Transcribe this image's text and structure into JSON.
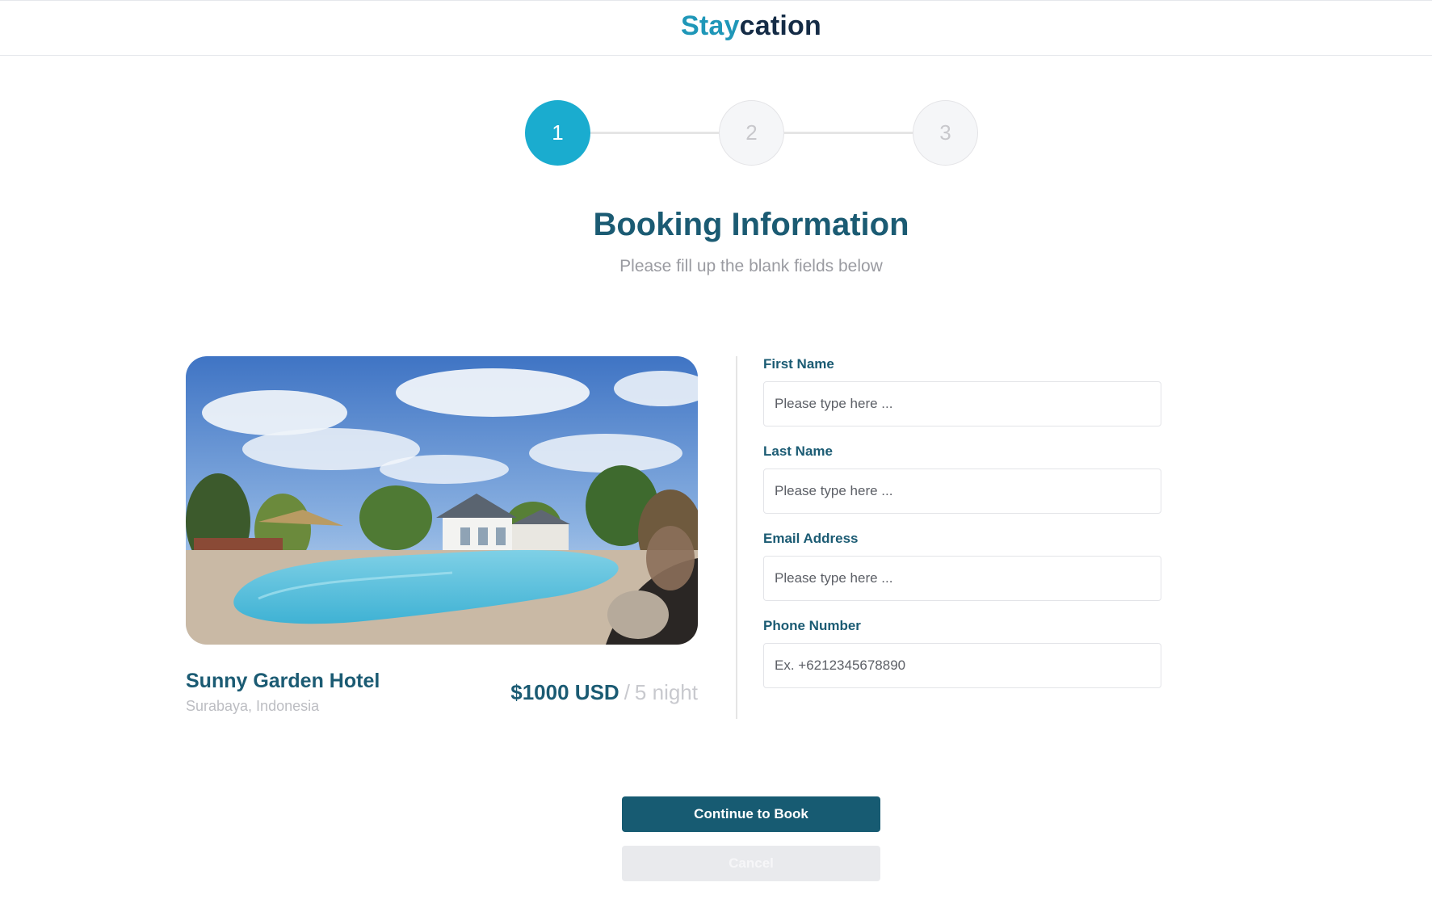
{
  "header": {
    "brand_part1": "Stay",
    "brand_part2": "cation"
  },
  "stepper": {
    "steps": [
      "1",
      "2",
      "3"
    ],
    "active_step": 1
  },
  "page": {
    "title": "Booking Information",
    "subtitle": "Please fill up the blank fields below"
  },
  "hotel": {
    "name": "Sunny Garden Hotel",
    "location": "Surabaya, Indonesia",
    "price": "$1000 USD",
    "separator": "/",
    "duration": "5 night"
  },
  "form": {
    "first_name": {
      "label": "First Name",
      "placeholder": "Please type here ...",
      "value": ""
    },
    "last_name": {
      "label": "Last Name",
      "placeholder": "Please type here ...",
      "value": ""
    },
    "email": {
      "label": "Email Address",
      "placeholder": "Please type here ...",
      "value": ""
    },
    "phone": {
      "label": "Phone Number",
      "placeholder": "Ex. +6212345678890",
      "value": ""
    }
  },
  "actions": {
    "continue_label": "Continue to Book",
    "cancel_label": "Cancel"
  },
  "colors": {
    "brand_accent": "#1f97b8",
    "brand_dark": "#152c46",
    "heading": "#1b5b73",
    "step_active": "#1aaccf",
    "primary_button": "#175b72",
    "cancel_button": "#e9eaed"
  },
  "image": {
    "name": "hotel-pool-photo"
  }
}
